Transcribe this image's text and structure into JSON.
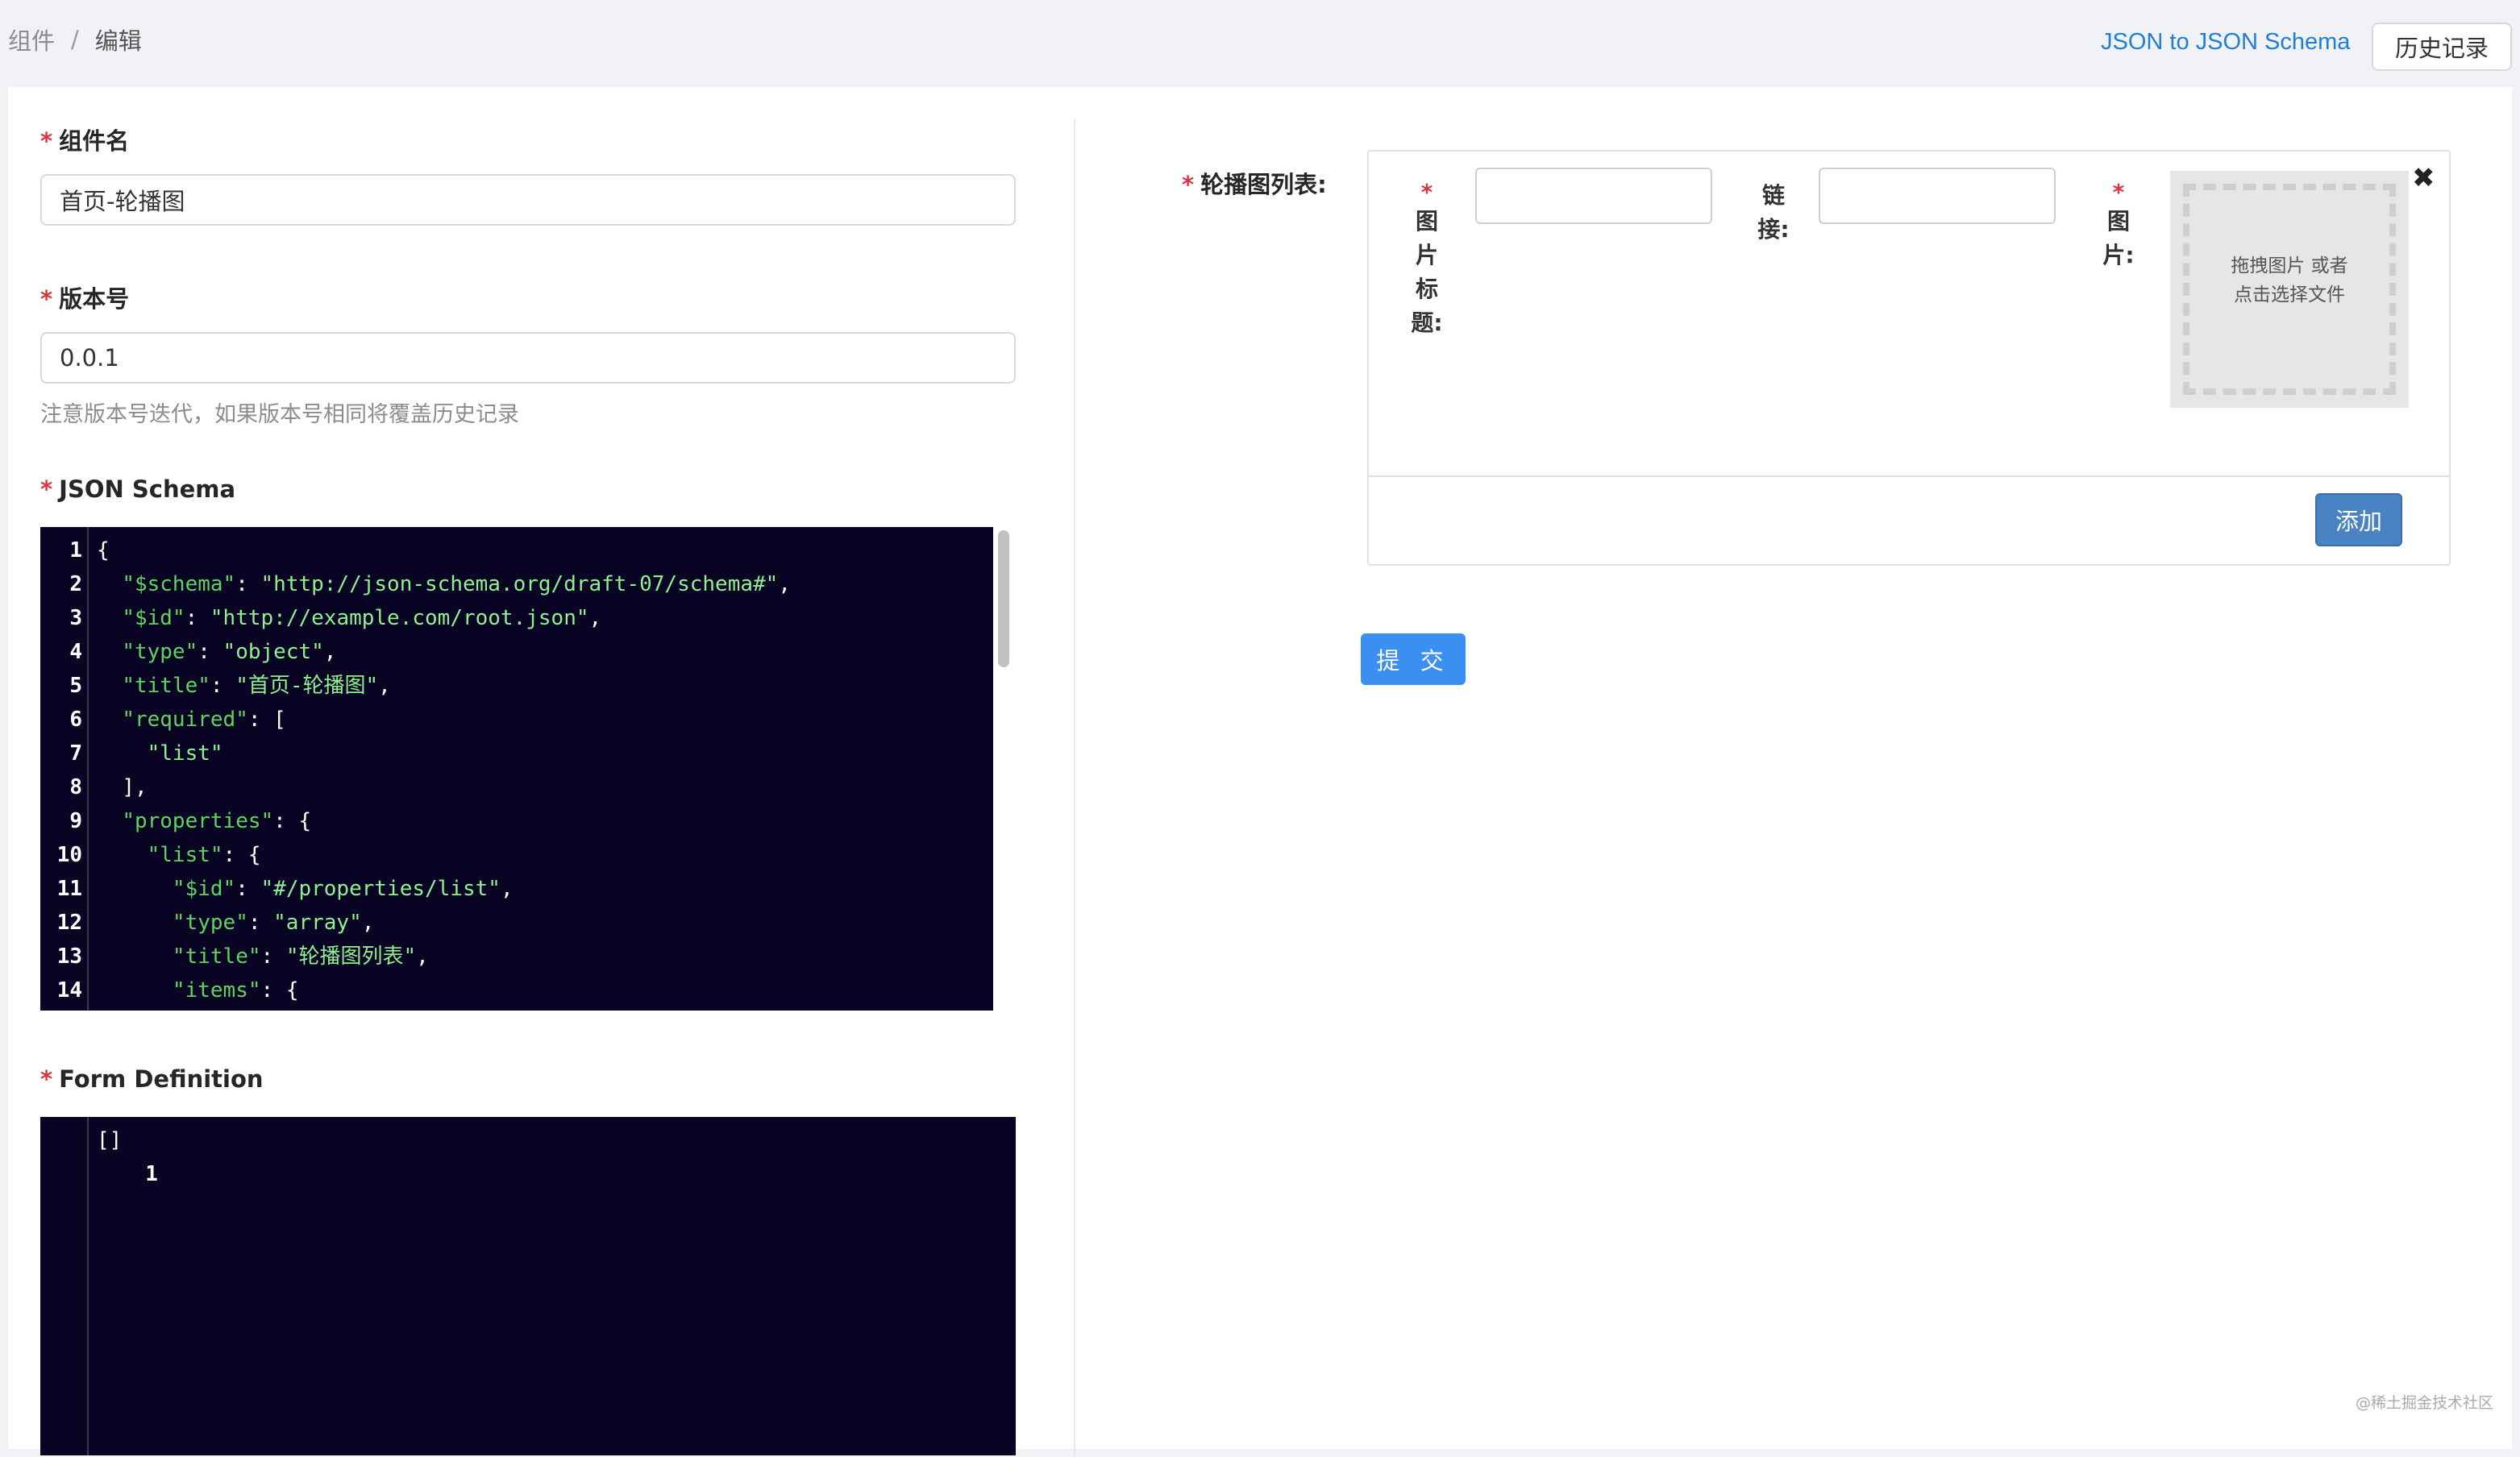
{
  "breadcrumb": {
    "parent": "组件",
    "separator": "/",
    "current": "编辑"
  },
  "header": {
    "json_link": "JSON to JSON Schema",
    "history_button": "历史记录"
  },
  "form": {
    "name_label": "组件名",
    "name_value": "首页-轮播图",
    "version_label": "版本号",
    "version_value": "0.0.1",
    "version_hint": "注意版本号迭代，如果版本号相同将覆盖历史记录",
    "schema_label": "JSON Schema",
    "form_def_label": "Form Definition"
  },
  "schema_editor": {
    "line_numbers": [
      "1",
      "2",
      "3",
      "4",
      "5",
      "6",
      "7",
      "8",
      "9",
      "10",
      "11",
      "12",
      "13",
      "14"
    ],
    "lines": [
      {
        "indent": "",
        "key": "",
        "colon": "",
        "value": "",
        "tail": "{"
      },
      {
        "indent": "  ",
        "key": "\"$schema\"",
        "colon": ": ",
        "value": "\"http://json-schema.org/draft-07/schema#\"",
        "tail": ","
      },
      {
        "indent": "  ",
        "key": "\"$id\"",
        "colon": ": ",
        "value": "\"http://example.com/root.json\"",
        "tail": ","
      },
      {
        "indent": "  ",
        "key": "\"type\"",
        "colon": ": ",
        "value": "\"object\"",
        "tail": ","
      },
      {
        "indent": "  ",
        "key": "\"title\"",
        "colon": ": ",
        "value": "\"首页-轮播图\"",
        "tail": ","
      },
      {
        "indent": "  ",
        "key": "\"required\"",
        "colon": ": ",
        "value": "",
        "tail": "["
      },
      {
        "indent": "    ",
        "key": "",
        "colon": "",
        "value": "\"list\"",
        "tail": ""
      },
      {
        "indent": "  ",
        "key": "",
        "colon": "",
        "value": "",
        "tail": "],"
      },
      {
        "indent": "  ",
        "key": "\"properties\"",
        "colon": ": ",
        "value": "",
        "tail": "{"
      },
      {
        "indent": "    ",
        "key": "\"list\"",
        "colon": ": ",
        "value": "",
        "tail": "{"
      },
      {
        "indent": "      ",
        "key": "\"$id\"",
        "colon": ": ",
        "value": "\"#/properties/list\"",
        "tail": ","
      },
      {
        "indent": "      ",
        "key": "\"type\"",
        "colon": ": ",
        "value": "\"array\"",
        "tail": ","
      },
      {
        "indent": "      ",
        "key": "\"title\"",
        "colon": ": ",
        "value": "\"轮播图列表\"",
        "tail": ","
      },
      {
        "indent": "      ",
        "key": "\"items\"",
        "colon": ": ",
        "value": "",
        "tail": "{"
      }
    ]
  },
  "form_def_editor": {
    "line_number": "1",
    "content": "[]"
  },
  "carousel": {
    "list_label": "轮播图列表:",
    "required_mark": "*",
    "image_title_label": [
      "图",
      "片",
      "标",
      "题:"
    ],
    "link_label": [
      "链",
      "接:"
    ],
    "image_label": [
      "图",
      "片:"
    ],
    "upload_text_line1": "拖拽图片 或者",
    "upload_text_line2": "点击选择文件",
    "close_glyph": "✖",
    "add_button": "添加"
  },
  "submit_button": "提 交",
  "watermark": "@稀土掘金技术社区",
  "colors": {
    "accent": "#3b8ff1",
    "link": "#1f7fd8",
    "required": "#d9363e",
    "editor_bg": "#0a0424",
    "code_string": "#8ff08f"
  }
}
